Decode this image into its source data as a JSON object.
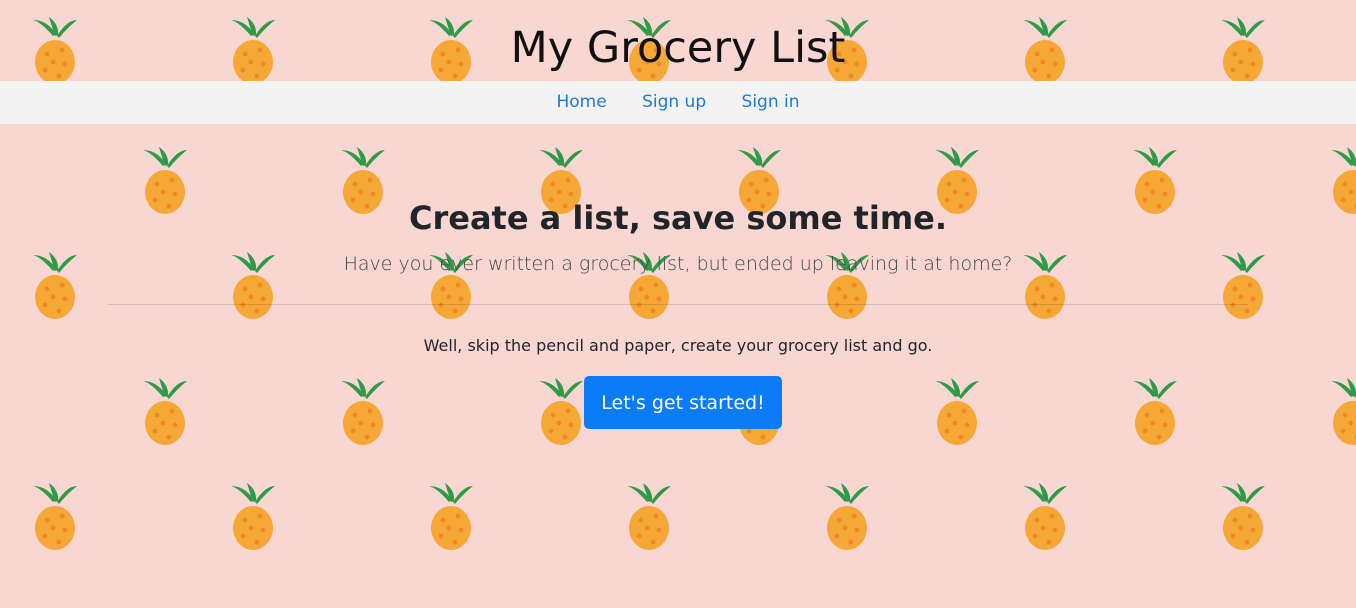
{
  "site": {
    "title": "My Grocery List"
  },
  "nav": {
    "items": [
      {
        "label": "Home"
      },
      {
        "label": "Sign up"
      },
      {
        "label": "Sign in"
      }
    ]
  },
  "hero": {
    "heading": "Create a list, save some time.",
    "lead": "Have you ever written a grocery list, but ended up leaving it at home?",
    "body": "Well, skip the pencil and paper, create your grocery list and go.",
    "cta_label": "Let's get started!"
  },
  "colors": {
    "background": "#f8d7d3",
    "navbar": "#f3f3f3",
    "link": "#1a7bd6",
    "button": "#0b7bf7",
    "pineapple_body": "#f6a837",
    "pineapple_leaves": "#2f9a48"
  },
  "icons": {
    "background_pattern": "pineapple-icon"
  }
}
